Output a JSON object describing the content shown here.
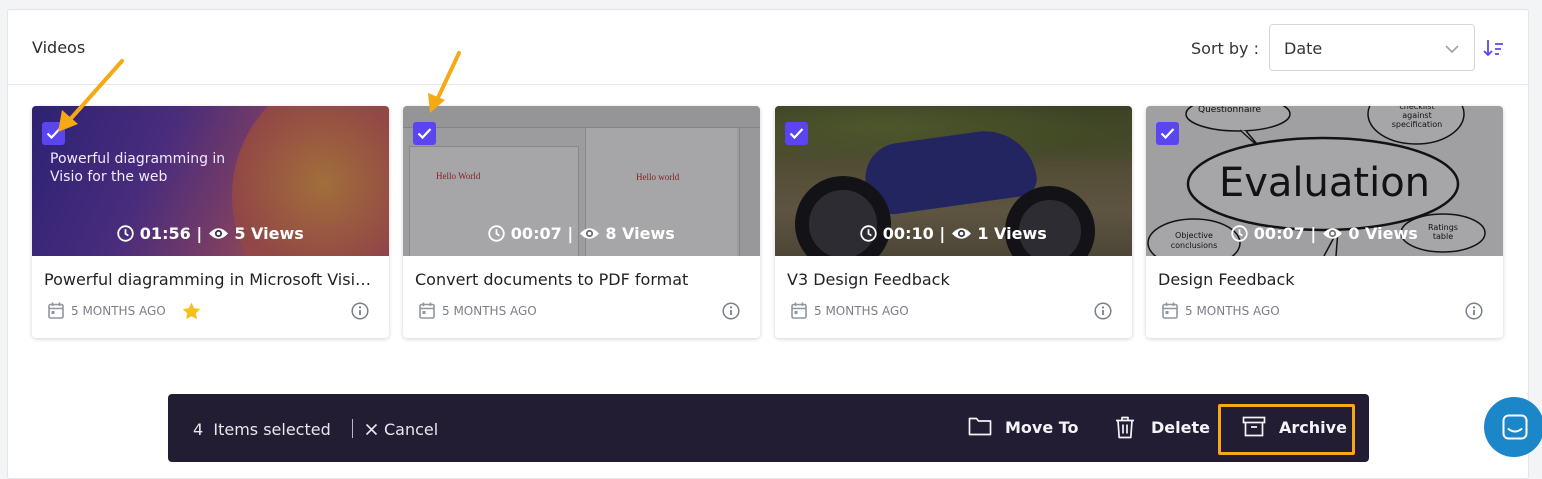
{
  "header": {
    "title": "Videos",
    "sort_label": "Sort by :",
    "sort_value": "Date"
  },
  "videos": [
    {
      "title": "Powerful diagramming in Microsoft Visio for the web",
      "duration": "01:56",
      "views": "5 Views",
      "age": "5 MONTHS AGO",
      "starred": true,
      "thumb_text": "Powerful diagramming in\nVisio for the web"
    },
    {
      "title": "Convert documents to PDF format",
      "duration": "00:07",
      "views": "8 Views",
      "age": "5 MONTHS AGO",
      "starred": false,
      "doc_text_left": "Hello World",
      "doc_text_right": "Hello world"
    },
    {
      "title": "V3 Design Feedback",
      "duration": "00:10",
      "views": "1 Views",
      "age": "5 MONTHS AGO",
      "starred": false
    },
    {
      "title": "Design Feedback",
      "duration": "00:07",
      "views": "0 Views",
      "age": "5 MONTHS AGO",
      "starred": false,
      "thumb_word": "Evaluation",
      "bubbles": [
        "Questionnaire",
        "checklist against specification",
        "Objective conclusions",
        "Ratings table"
      ]
    }
  ],
  "action_bar": {
    "count": "4",
    "selected_label": "Items selected",
    "cancel_label": "Cancel",
    "move_label": "Move To",
    "delete_label": "Delete",
    "archive_label": "Archive"
  },
  "colors": {
    "accent": "#5b45f0",
    "highlight": "#f5a914",
    "bar_bg": "#221d32",
    "chat": "#1b86c8"
  }
}
